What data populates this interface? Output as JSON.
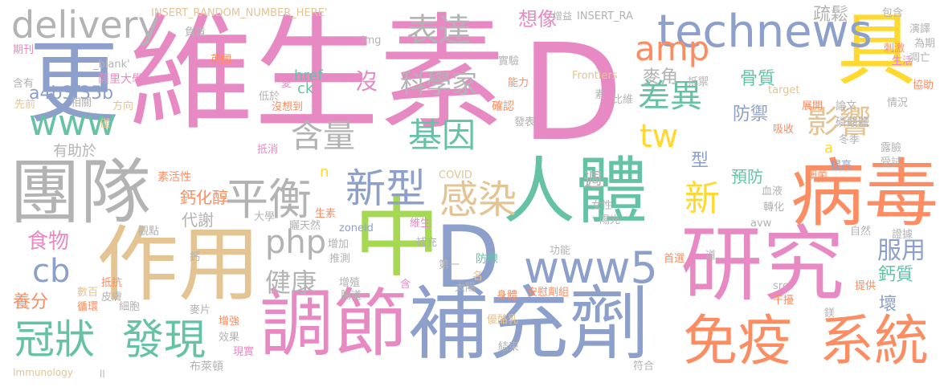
{
  "colors": {
    "pink": "#e78ac3",
    "green": "#66c2a5",
    "orange": "#fc8d62",
    "blue": "#8da0cb",
    "lime": "#a6d854",
    "yellow": "#ffd92f",
    "tan": "#e5c494",
    "gray": "#b3b3b3"
  },
  "words": [
    {
      "text": "維生素"
    },
    {
      "text": "D"
    },
    {
      "text": "補充劑"
    },
    {
      "text": "研究"
    },
    {
      "text": "作用"
    },
    {
      "text": "調節"
    },
    {
      "text": "更"
    },
    {
      "text": "團隊"
    },
    {
      "text": "病毒"
    },
    {
      "text": "中"
    },
    {
      "text": "D"
    },
    {
      "text": "人體"
    },
    {
      "text": "免疫"
    },
    {
      "text": "系統"
    },
    {
      "text": "冠狀"
    },
    {
      "text": "發現"
    },
    {
      "text": "具"
    },
    {
      "text": "technews"
    },
    {
      "text": "www5"
    },
    {
      "text": "平衡"
    },
    {
      "text": "新型"
    },
    {
      "text": "感染"
    },
    {
      "text": "delivery"
    },
    {
      "text": "www"
    },
    {
      "text": "php"
    },
    {
      "text": "表達"
    },
    {
      "text": "amp"
    },
    {
      "text": "差異"
    },
    {
      "text": "影響"
    },
    {
      "text": "含量"
    },
    {
      "text": "基因"
    },
    {
      "text": "tw"
    },
    {
      "text": "新"
    },
    {
      "text": "科學家"
    },
    {
      "text": "健康"
    },
    {
      "text": "cb"
    },
    {
      "text": "食物"
    },
    {
      "text": "服用"
    },
    {
      "text": "a4b3f35b"
    },
    {
      "text": "想像"
    },
    {
      "text": "疏鬆"
    },
    {
      "text": "麥角"
    },
    {
      "text": "骨質"
    },
    {
      "text": "防禦"
    },
    {
      "text": "預防"
    },
    {
      "text": "鈣化醇"
    },
    {
      "text": "代謝"
    },
    {
      "text": "鈣質"
    },
    {
      "text": "有助於"
    },
    {
      "text": "沒"
    },
    {
      "text": "href"
    },
    {
      "text": "ck"
    },
    {
      "text": "週"
    },
    {
      "text": "型"
    },
    {
      "text": "養分"
    },
    {
      "text": "壞"
    },
    {
      "text": "n"
    },
    {
      "text": "a"
    },
    {
      "text": "INSERT_RANDOM_NUMBER_HERE'"
    },
    {
      "text": "INSERT_RA"
    },
    {
      "text": "增益"
    },
    {
      "text": "包含"
    },
    {
      "text": "負責"
    },
    {
      "text": "期刊"
    },
    {
      "text": "_blank'"
    },
    {
      "text": "英國"
    },
    {
      "text": "薩里大學"
    },
    {
      "text": "含有"
    },
    {
      "text": "先前"
    },
    {
      "text": "相關"
    },
    {
      "text": "方向"
    },
    {
      "text": "僅"
    },
    {
      "text": "img"
    },
    {
      "text": "實驗"
    },
    {
      "text": "Frontiers"
    },
    {
      "text": "能力"
    },
    {
      "text": "確認"
    },
    {
      "text": "素"
    },
    {
      "text": "比維"
    },
    {
      "text": "抵禦"
    },
    {
      "text": "target"
    },
    {
      "text": "展開"
    },
    {
      "text": "論文"
    },
    {
      "text": "磷酸鹽"
    },
    {
      "text": "吸收"
    },
    {
      "text": "情況"
    },
    {
      "text": "協助"
    },
    {
      "text": "刺激"
    },
    {
      "text": "演譯"
    },
    {
      "text": "為期"
    },
    {
      "text": "凋亡"
    },
    {
      "text": "生活"
    },
    {
      "text": "低於"
    },
    {
      "text": "愛"
    },
    {
      "text": "沒想到"
    },
    {
      "text": "發表"
    },
    {
      "text": "抵消"
    },
    {
      "text": "冬季"
    },
    {
      "text": "提高"
    },
    {
      "text": "露臉"
    },
    {
      "text": "受試"
    },
    {
      "text": "素活性"
    },
    {
      "text": "COVID"
    },
    {
      "text": "細菌"
    },
    {
      "text": "血液"
    },
    {
      "text": "轉化"
    },
    {
      "text": "avw"
    },
    {
      "text": "自然"
    },
    {
      "text": "證據"
    },
    {
      "text": "曬天然"
    },
    {
      "text": "zoneid"
    },
    {
      "text": "大學"
    },
    {
      "text": "生素"
    },
    {
      "text": "女性"
    },
    {
      "text": "陽光"
    },
    {
      "text": "維生"
    },
    {
      "text": "觀點"
    },
    {
      "text": "鈣"
    },
    {
      "text": "增加"
    },
    {
      "text": "推測"
    },
    {
      "text": "補充"
    },
    {
      "text": "第一"
    },
    {
      "text": "防線"
    },
    {
      "text": "功能"
    },
    {
      "text": "首選"
    },
    {
      "text": "道"
    },
    {
      "text": "抵抗"
    },
    {
      "text": "皮膚"
    },
    {
      "text": "數百"
    },
    {
      "text": "循環"
    },
    {
      "text": "細胞"
    },
    {
      "text": "麥片"
    },
    {
      "text": "增殖"
    },
    {
      "text": "腸道"
    },
    {
      "text": "含"
    },
    {
      "text": "名"
    },
    {
      "text": "太陽"
    },
    {
      "text": "身體"
    },
    {
      "text": "安慰劑組"
    },
    {
      "text": "src"
    },
    {
      "text": "干擾"
    },
    {
      "text": "提供"
    },
    {
      "text": "增強"
    },
    {
      "text": "效果"
    },
    {
      "text": "現實"
    },
    {
      "text": "優酪乳"
    },
    {
      "text": "鎂"
    },
    {
      "text": "結束"
    },
    {
      "text": "布萊頓"
    },
    {
      "text": "Immunology"
    },
    {
      "text": "ll"
    },
    {
      "text": "符合"
    }
  ]
}
